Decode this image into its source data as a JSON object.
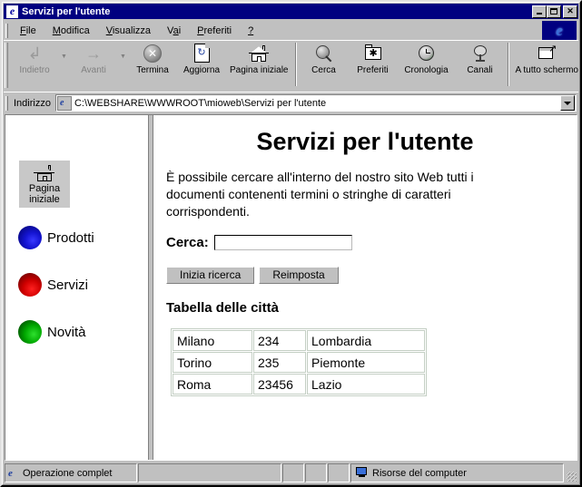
{
  "window": {
    "title": "Servizi per l'utente",
    "icon": "ie-document-icon",
    "buttons": {
      "minimize": "_",
      "maximize": "□",
      "close": "×"
    }
  },
  "menu": {
    "items": [
      {
        "label": "File",
        "accel": "F"
      },
      {
        "label": "Modifica",
        "accel": "M"
      },
      {
        "label": "Visualizza",
        "accel": "V"
      },
      {
        "label": "Vai",
        "accel": "a"
      },
      {
        "label": "Preferiti",
        "accel": "P"
      },
      {
        "label": "?",
        "accel": ""
      }
    ]
  },
  "toolbar": {
    "buttons": [
      {
        "label": "Indietro",
        "icon": "back-arrow-icon",
        "disabled": true,
        "dropdown": true
      },
      {
        "label": "Avanti",
        "icon": "forward-arrow-icon",
        "disabled": true,
        "dropdown": true
      },
      {
        "label": "Termina",
        "icon": "stop-icon",
        "disabled": false
      },
      {
        "label": "Aggiorna",
        "icon": "refresh-icon",
        "disabled": false
      },
      {
        "label": "Pagina iniziale",
        "icon": "home-icon",
        "disabled": false
      },
      {
        "label": "Cerca",
        "icon": "search-globe-icon",
        "disabled": false
      },
      {
        "label": "Preferiti",
        "icon": "favorites-folder-icon",
        "disabled": false
      },
      {
        "label": "Cronologia",
        "icon": "history-clock-icon",
        "disabled": false
      },
      {
        "label": "Canali",
        "icon": "channels-dish-icon",
        "disabled": false
      },
      {
        "label": "A tutto schermo",
        "icon": "fullscreen-icon",
        "disabled": false
      }
    ]
  },
  "address": {
    "label": "Indirizzo",
    "value": "C:\\WEBSHARE\\WWWROOT\\mioweb\\Servizi per l'utente",
    "icon": "page-icon",
    "dropdown_icon": "chevron-down-icon"
  },
  "sidebar": {
    "home_button": {
      "line1": "Pagina",
      "line2": "iniziale",
      "icon": "home-icon"
    },
    "links": [
      {
        "label": "Prodotti",
        "bullet_color": "#1414d2",
        "bullet": "blue-sphere-icon"
      },
      {
        "label": "Servizi",
        "bullet_color": "#d00000",
        "bullet": "red-sphere-icon"
      },
      {
        "label": "Novità",
        "bullet_color": "#00a800",
        "bullet": "green-sphere-icon"
      }
    ]
  },
  "main": {
    "title": "Servizi per l'utente",
    "intro": "È possibile cercare all'interno del nostro sito Web tutti i documenti contenenti termini o stringhe di caratteri corrispondenti.",
    "search": {
      "label": "Cerca:",
      "value": "",
      "placeholder": ""
    },
    "buttons": {
      "submit": "Inizia ricerca",
      "reset": "Reimposta"
    },
    "table_title": "Tabella delle città",
    "table": {
      "border_color": "#c4cfc4",
      "rows": [
        [
          "Milano",
          "234",
          "Lombardia"
        ],
        [
          "Torino",
          "235",
          "Piemonte"
        ],
        [
          "Roma",
          "23456",
          "Lazio"
        ]
      ]
    }
  },
  "statusbar": {
    "message": "Operazione complet",
    "zone": "Risorse del computer",
    "message_icon": "ie-icon",
    "zone_icon": "my-computer-icon"
  }
}
